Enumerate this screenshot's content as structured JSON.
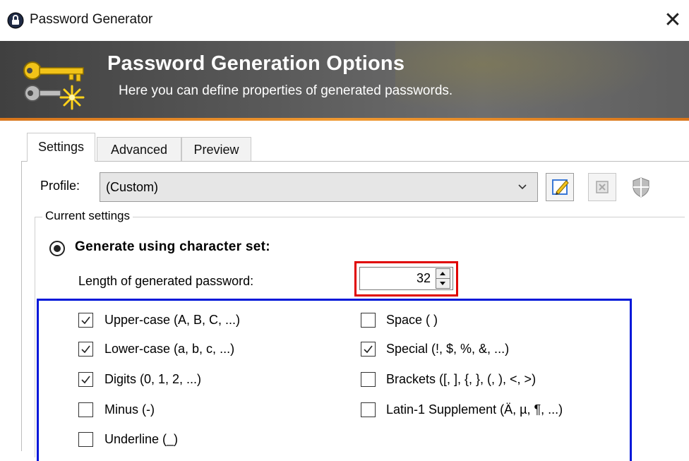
{
  "window": {
    "title": "Password Generator",
    "close_glyph": "✕"
  },
  "banner": {
    "title": "Password Generation Options",
    "subtitle": "Here you can define properties of generated passwords."
  },
  "tabs": [
    {
      "label": "Settings",
      "active": true
    },
    {
      "label": "Advanced",
      "active": false
    },
    {
      "label": "Preview",
      "active": false
    }
  ],
  "profile": {
    "label": "Profile:",
    "value": "(Custom)"
  },
  "current_settings": {
    "group_label": "Current settings",
    "mode_label": "Generate using character set:",
    "mode_selected": true,
    "length_label": "Length of generated password:",
    "length_value": "32"
  },
  "charsets": {
    "left": [
      {
        "label": "Upper-case (A, B, C, ...)",
        "checked": true
      },
      {
        "label": "Lower-case (a, b, c, ...)",
        "checked": true
      },
      {
        "label": "Digits (0, 1, 2, ...)",
        "checked": true
      },
      {
        "label": "Minus (-)",
        "checked": false
      },
      {
        "label": "Underline (_)",
        "checked": false
      }
    ],
    "right": [
      {
        "label": "Space ( )",
        "checked": false
      },
      {
        "label": "Special (!, $, %, &, ...)",
        "checked": true
      },
      {
        "label": "Brackets ([, ], {, }, (, ), <, >)",
        "checked": false
      },
      {
        "label": "Latin-1 Supplement (Ä, µ, ¶, ...)",
        "checked": false
      }
    ]
  },
  "colors": {
    "highlight_red": "#e00000",
    "highlight_blue": "#0017d9",
    "banner_accent": "#f09a32"
  }
}
